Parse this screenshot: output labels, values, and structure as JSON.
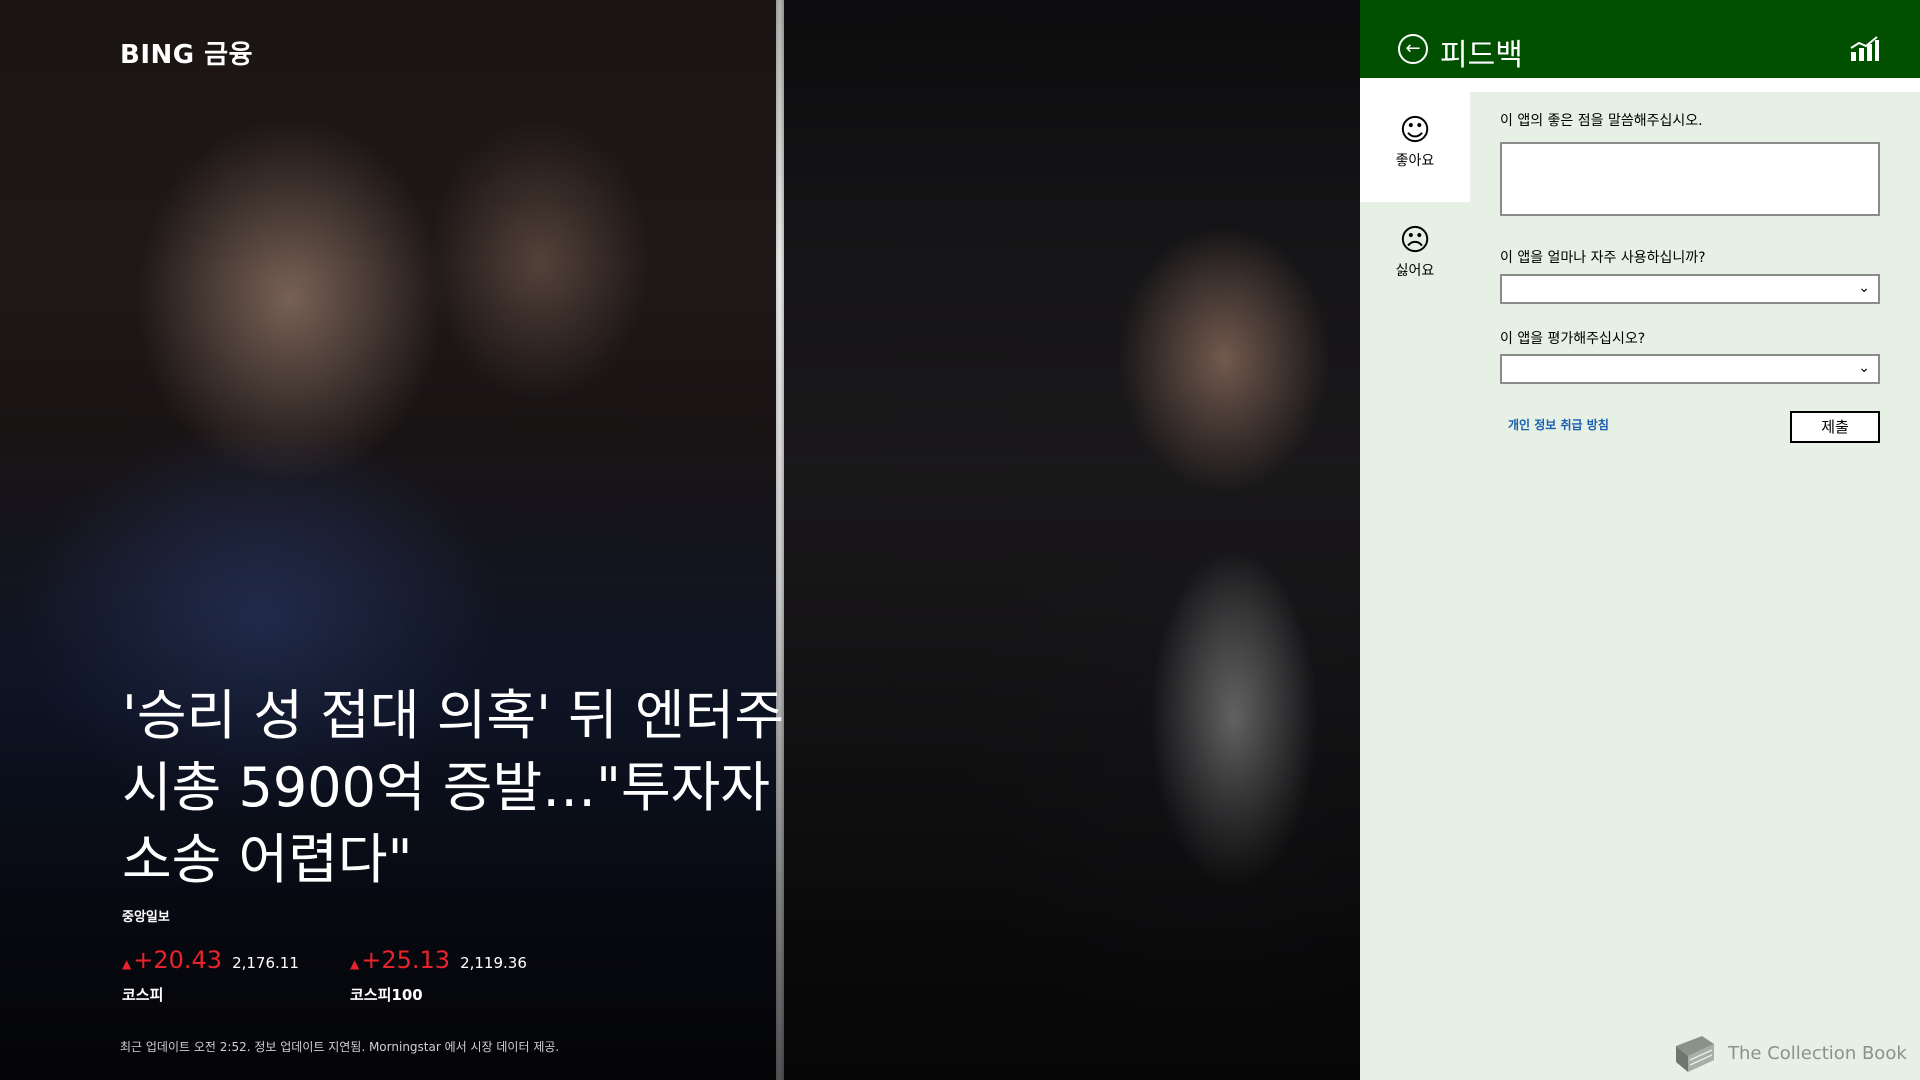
{
  "app": {
    "title": "BING 금융"
  },
  "article": {
    "headline_lines": [
      "'승리 성 접대 의혹' 뒤 엔터주",
      "시총 5900억 증발…\"투자자",
      "소송 어렵다\""
    ],
    "source": "중앙일보"
  },
  "tickers": [
    {
      "name": "코스피",
      "change": "+20.43",
      "value": "2,176.11",
      "direction": "up"
    },
    {
      "name": "코스피100",
      "change": "+25.13",
      "value": "2,119.36",
      "direction": "up"
    }
  ],
  "footnote": "최근 업데이트 오전 2:52. 정보 업데이트 지연됨. Morningstar 에서 시장 데이터 제공.",
  "feedback": {
    "title": "피드백",
    "back_icon": "back-arrow-circle-icon",
    "header_icon": "chart-icon",
    "tabs": [
      {
        "label": "좋아요",
        "icon": "smile-face-icon",
        "selected": true
      },
      {
        "label": "싫어요",
        "icon": "frown-face-icon",
        "selected": false
      }
    ],
    "questions": {
      "good_points": "이 앱의 좋은 점을 말씀해주십시오.",
      "frequency": "이 앱을 얼마나 자주 사용하십니까?",
      "rating": "이 앱을 평가해주십시오?"
    },
    "good_points_value": "",
    "frequency_value": "",
    "rating_value": "",
    "privacy_link": "개인 정보 취급 방침",
    "submit_label": "제출"
  },
  "watermark": "The Collection Book",
  "colors": {
    "header_green": "#005000",
    "pane_bg": "#e6f0e4",
    "up_red": "#e8232b",
    "link_blue": "#1b5fb0"
  }
}
